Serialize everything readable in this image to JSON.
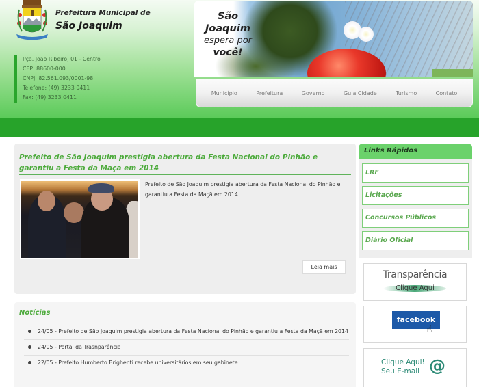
{
  "header": {
    "brand_subtitle": "Prefeitura Municipal de",
    "brand_title": "São Joaquim",
    "address": [
      "Pça. João Ribeiro, 01 - Centro",
      "CEP: 88600-000",
      "CNPJ: 82.561.093/0001-98",
      "Telefone: (49) 3233 0411",
      "Fax: (49) 3233 0411"
    ],
    "banner": {
      "line1": "São Joaquim",
      "line2": "espera por",
      "line3": "você!"
    }
  },
  "nav": {
    "items": [
      "Município",
      "Prefeitura",
      "Governo",
      "Guia Cidade",
      "Turismo",
      "Contato"
    ]
  },
  "feature": {
    "title": "Prefeito de São Joaquim prestigia abertura da Festa Nacional do Pinhão e garantiu a Festa da Maçã em 2014",
    "summary": "Prefeito de São Joaquim prestigia abertura da Festa Nacional do Pinhão e garantiu a Festa da Maçã em 2014",
    "read_more_label": "Leia mais"
  },
  "news": {
    "title": "Notícias",
    "items": [
      "24/05 - Prefeito de São Joaquim prestigia abertura da Festa Nacional do Pinhão e garantiu a Festa da Maçã em 2014",
      "24/05 - Portal da Trasnparência",
      "22/05 - Prefeito Humberto Brighenti recebe universitários em seu gabinete"
    ]
  },
  "sidebar": {
    "quick_links_title": "Links Rápidos",
    "quick_links": [
      "LRF",
      "Licitações",
      "Concursos Públicos",
      "Diário Oficial"
    ],
    "transparency": {
      "title": "Transparência",
      "subtitle": "Clique Aqui"
    },
    "facebook": {
      "label": "facebook"
    },
    "email": {
      "line1": "Clique Aqui!",
      "line2": "Seu E-mail",
      "symbol": "@"
    }
  },
  "colors": {
    "brand_green": "#27a32a",
    "accent_green": "#4caa3b",
    "quick_header": "#6bd26b",
    "facebook_blue": "#1d59a8"
  }
}
